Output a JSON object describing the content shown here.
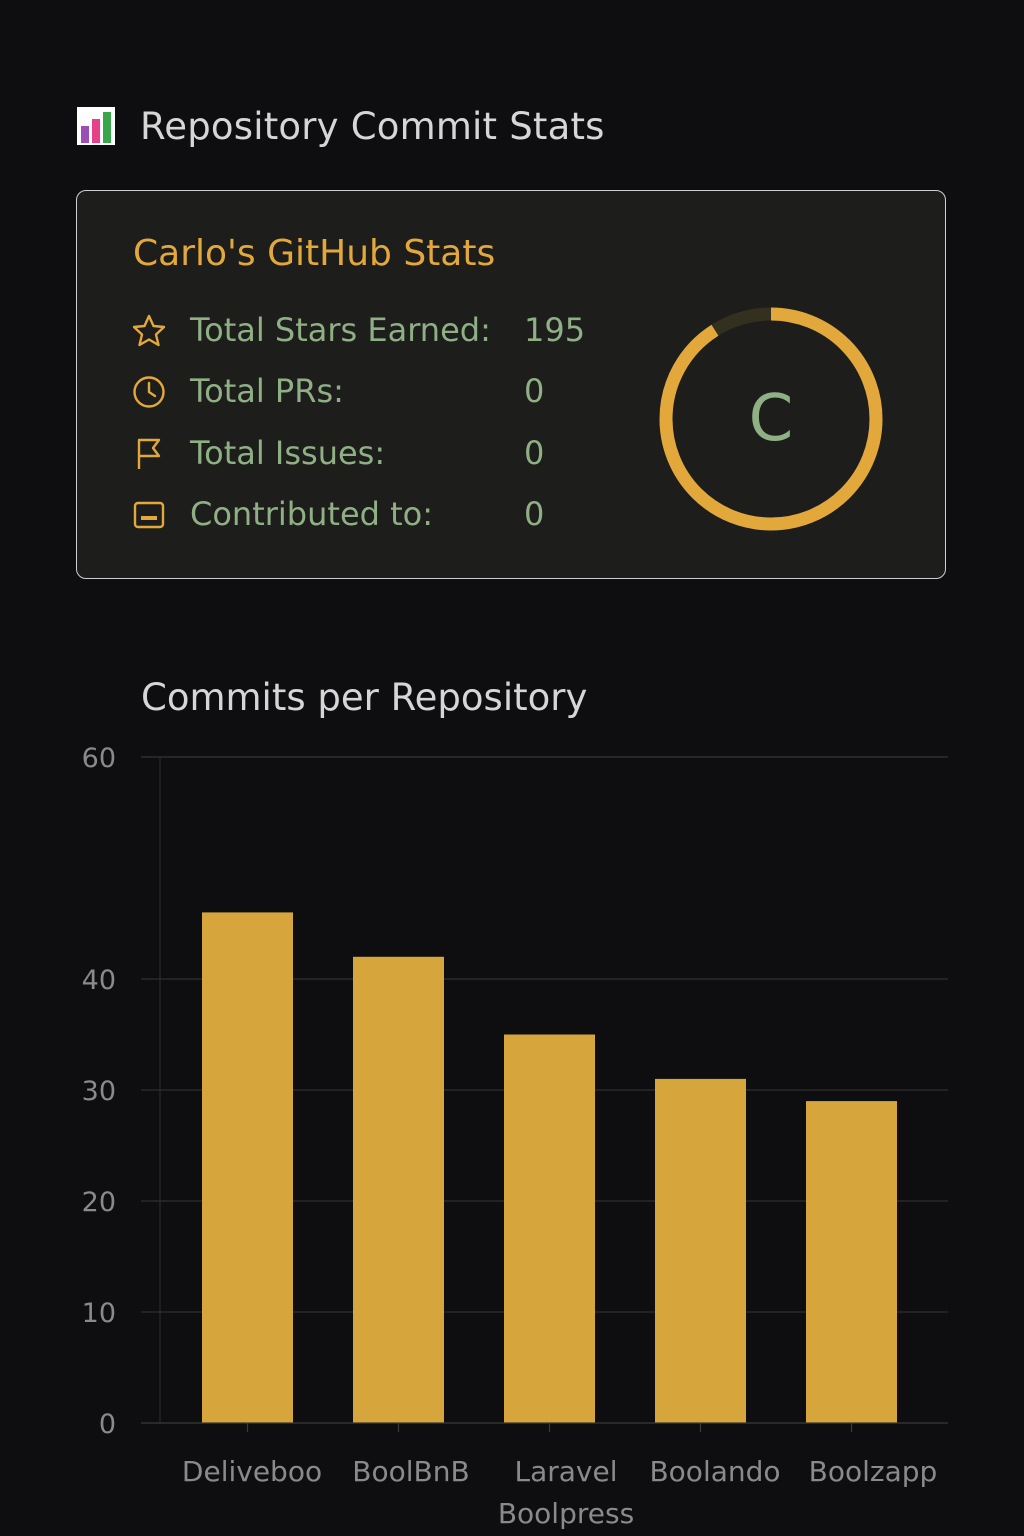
{
  "header": {
    "icon": "bar-chart-icon",
    "title": "Repository Commit Stats"
  },
  "stats_card": {
    "title": "Carlo's GitHub Stats",
    "stats": [
      {
        "icon": "star-icon",
        "label": "Total Stars Earned:",
        "value": "195"
      },
      {
        "icon": "clock-icon",
        "label": "Total PRs:",
        "value": "0"
      },
      {
        "icon": "flag-icon",
        "label": "Total Issues:",
        "value": "0"
      },
      {
        "icon": "repo-icon",
        "label": "Contributed to:",
        "value": "0"
      }
    ],
    "rank": {
      "grade": "C",
      "progress": 0.91
    },
    "colors": {
      "accent": "#e3a83b",
      "text": "#8fb085"
    }
  },
  "chart_data": {
    "type": "bar",
    "title": "Commits per Repository",
    "categories": [
      "Deliveboo",
      "BoolBnB",
      "Laravel Boolpress",
      "Boolando",
      "Boolzapp"
    ],
    "category_lines": [
      [
        "Deliveboo"
      ],
      [
        "BoolBnB"
      ],
      [
        "Laravel",
        "Boolpress"
      ],
      [
        "Boolando"
      ],
      [
        "Boolzapp"
      ]
    ],
    "values": [
      46,
      42,
      35,
      31,
      29
    ],
    "ylim": [
      0,
      60
    ],
    "yticks": [
      0,
      10,
      20,
      30,
      40,
      60
    ],
    "grid": true,
    "bar_color": "#d6a63d"
  }
}
